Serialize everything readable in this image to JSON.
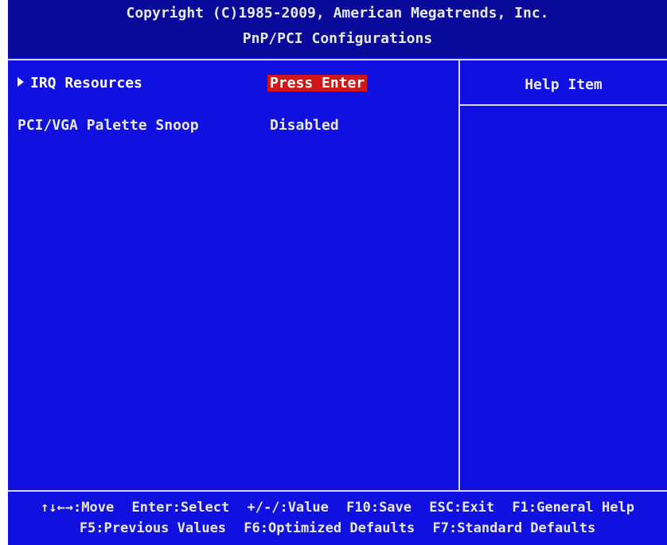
{
  "header": {
    "copyright": "Copyright (C)1985-2009, American Megatrends, Inc.",
    "title": "PnP/PCI Configurations"
  },
  "settings": [
    {
      "label": "IRQ Resources",
      "value": "Press Enter",
      "submenu": true
    },
    {
      "label": "PCI/VGA Palette Snoop",
      "value": "Disabled",
      "submenu": false
    }
  ],
  "help": {
    "title": "Help Item"
  },
  "footer": {
    "line1": [
      "↑↓←→:Move",
      "Enter:Select",
      "+/-/:Value",
      "F10:Save",
      "ESC:Exit",
      "F1:General Help"
    ],
    "line2": [
      "F5:Previous Values",
      "F6:Optimized Defaults",
      "F7:Standard Defaults"
    ]
  },
  "colors": {
    "background": "#1010e0",
    "header_bg": "#0a0a9a",
    "highlight": "#d01818",
    "text": "#e8e8e8"
  }
}
